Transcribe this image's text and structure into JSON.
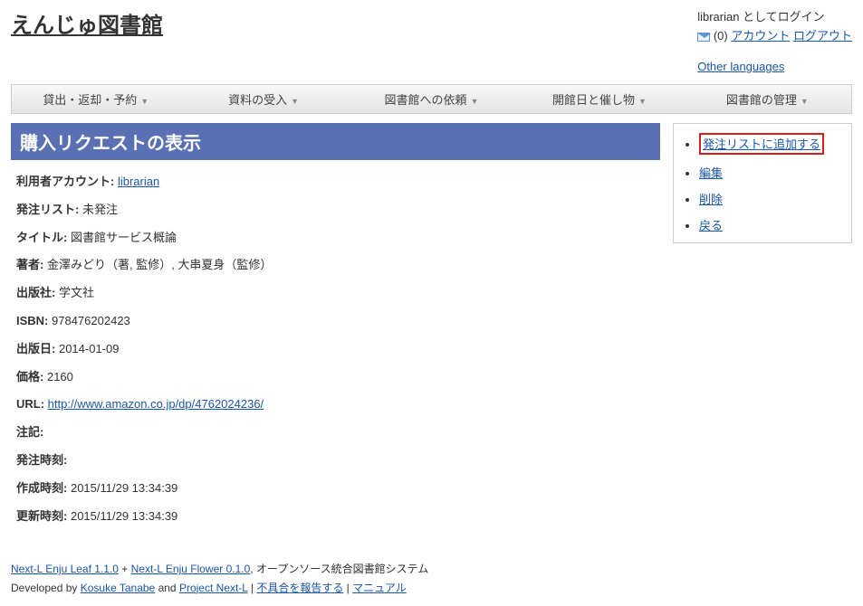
{
  "header": {
    "site_title": "えんじゅ図書館",
    "login_as": "librarian としてログイン",
    "msg_count": "(0)",
    "account_link": "アカウント",
    "logout_link": "ログアウト",
    "other_languages": "Other languages"
  },
  "nav": {
    "items": [
      "貸出・返却・予約",
      "資料の受入",
      "図書館への依頼",
      "開館日と催し物",
      "図書館の管理"
    ]
  },
  "page": {
    "title": "購入リクエストの表示"
  },
  "fields": {
    "user_account": {
      "label": "利用者アカウント:",
      "value": "librarian",
      "is_link": true
    },
    "order_list": {
      "label": "発注リスト:",
      "value": "未発注"
    },
    "title": {
      "label": "タイトル:",
      "value": "図書館サービス概論"
    },
    "author": {
      "label": "著者:",
      "value": "金澤みどり（著, 監修）, 大串夏身（監修）"
    },
    "publisher": {
      "label": "出版社:",
      "value": "学文社"
    },
    "isbn": {
      "label": "ISBN:",
      "value": "978476202423"
    },
    "pubdate": {
      "label": "出版日:",
      "value": "2014-01-09"
    },
    "price": {
      "label": "価格:",
      "value": "2160"
    },
    "url": {
      "label": "URL:",
      "value": "http://www.amazon.co.jp/dp/4762024236/",
      "is_link": true
    },
    "note": {
      "label": "注記:",
      "value": ""
    },
    "ordered_at": {
      "label": "発注時刻:",
      "value": ""
    },
    "created_at": {
      "label": "作成時刻:",
      "value": "2015/11/29 13:34:39"
    },
    "updated_at": {
      "label": "更新時刻:",
      "value": "2015/11/29 13:34:39"
    }
  },
  "sidebar": {
    "items": [
      {
        "label": "発注リストに追加する",
        "highlight": true
      },
      {
        "label": "編集"
      },
      {
        "label": "削除"
      },
      {
        "label": "戻る"
      }
    ]
  },
  "footer": {
    "leaf_link": "Next-L Enju Leaf 1.1.0",
    "plus": " + ",
    "flower_link": "Next-L Enju Flower 0.1.0",
    "tagline": ", オープンソース統合図書館システム",
    "dev_by": "Developed by ",
    "kosuke": "Kosuke Tanabe",
    "and": " and ",
    "project": "Project Next-L",
    "sep": " | ",
    "report": "不具合を報告する",
    "manual": "マニュアル"
  }
}
